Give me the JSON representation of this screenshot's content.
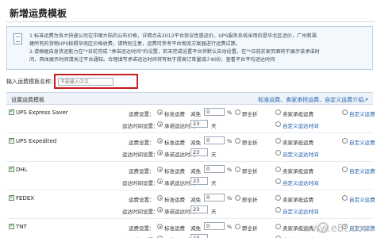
{
  "page": {
    "title": "新增运费模板"
  },
  "notice": {
    "line1": "1.标准运费为各大快递公司在中国大陆的公布价格，详情点击2012平台协议优惠运价。UPS服务系统采用的是华北区运价，广州和福",
    "line2": "建所有的货物UPS按照华南区价格收费，请特别注意，运费可参考平台物流方案器进行运费试算。",
    "line3": "2.请根据自身货运能力在\"*日前完成 \"承诺运达时间\"的设置，若未完成设置平台将默认自动设置。在\"*日前买家页面将不展示该承诺时",
    "line4": "间，具体展示时间请关注平台通知。合理填写承诺运达时间将有助于提高订单量减少纠纷，查看平台平均运达时间"
  },
  "template_name": {
    "label": "输入运费模板名称：",
    "placeholder": "不能输入中文"
  },
  "settings": {
    "header_label": "设置运费模板",
    "links": "标准运费、卖家承担运费、自定义运费介绍↗"
  },
  "row_labels": {
    "freight_setting": "运费设置：",
    "standard_freight": "标准运费",
    "discount": "减免",
    "discount_value": "0",
    "percent": "%",
    "full_discount": "即全折",
    "seller_pays": "卖家承担运费",
    "custom_freight": "自定义运费",
    "delivery_time": "运达时间设置：",
    "promised_time": "承诺运达时间",
    "days_value": "23",
    "days_unit": "天",
    "custom_time": "自定义运达时间"
  },
  "carriers": [
    {
      "name": "UPS Express Saver"
    },
    {
      "name": "UPS Expedited"
    },
    {
      "name": "DHL"
    },
    {
      "name": "FEDEX"
    },
    {
      "name": "TNT"
    }
  ],
  "watermark": {
    "text": "www.e8t.com"
  }
}
